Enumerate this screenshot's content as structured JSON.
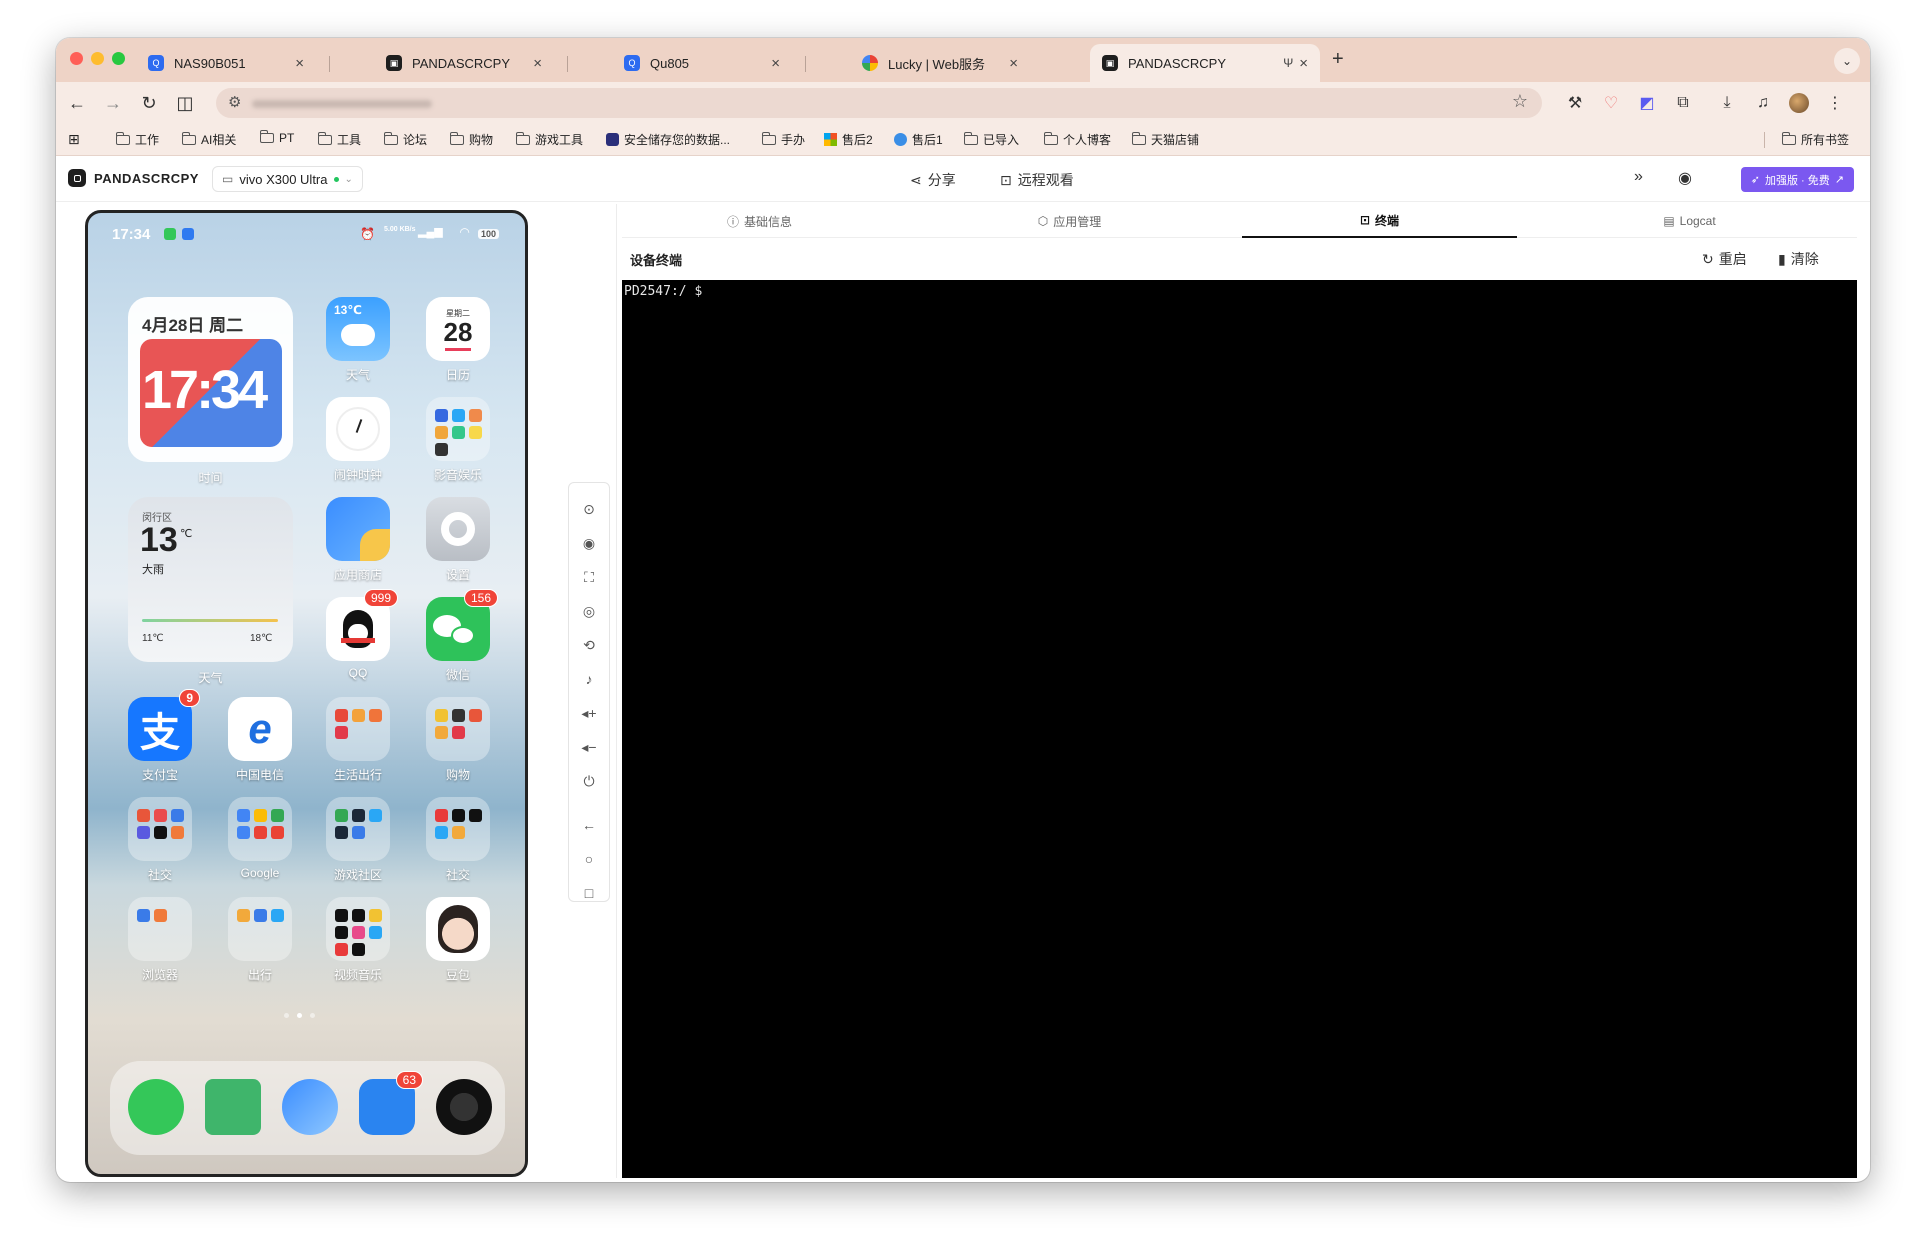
{
  "browser": {
    "tabs": [
      {
        "title": "NAS90B051",
        "favicon": "qnap-icon",
        "active": false
      },
      {
        "title": "PANDASCRCPY",
        "favicon": "pandascrcpy-icon",
        "active": false
      },
      {
        "title": "Qu805",
        "favicon": "qnap-icon",
        "active": false
      },
      {
        "title": "Lucky | Web服务",
        "favicon": "lucky-icon",
        "active": false
      },
      {
        "title": "PANDASCRCPY",
        "favicon": "pandascrcpy-icon",
        "active": true
      }
    ],
    "bookmarks": [
      {
        "label": "工作",
        "icon": "folder-icon"
      },
      {
        "label": "AI相关",
        "icon": "folder-icon"
      },
      {
        "label": "PT",
        "icon": "folder-icon"
      },
      {
        "label": "工具",
        "icon": "folder-icon"
      },
      {
        "label": "论坛",
        "icon": "folder-icon"
      },
      {
        "label": "购物",
        "icon": "folder-icon"
      },
      {
        "label": "游戏工具",
        "icon": "folder-icon"
      },
      {
        "label": "安全储存您的数据...",
        "icon": "app-icon"
      },
      {
        "label": "手办",
        "icon": "folder-icon"
      },
      {
        "label": "售后2",
        "icon": "windows-icon"
      },
      {
        "label": "售后1",
        "icon": "azure-icon"
      },
      {
        "label": "已导入",
        "icon": "folder-icon"
      },
      {
        "label": "个人博客",
        "icon": "folder-icon"
      },
      {
        "label": "天猫店铺",
        "icon": "folder-icon"
      }
    ],
    "all_bookmarks": "所有书签"
  },
  "app": {
    "brand": "PANDASCRCPY",
    "device": "vivo X300 Ultra",
    "share": "分享",
    "remote_view": "远程观看",
    "pro_button": "加强版 · 免费",
    "tabs": [
      {
        "label": "基础信息",
        "icon": "info-icon"
      },
      {
        "label": "应用管理",
        "icon": "package-icon"
      },
      {
        "label": "终端",
        "icon": "terminal-icon"
      },
      {
        "label": "Logcat",
        "icon": "log-icon"
      }
    ],
    "active_tab": "终端",
    "terminal": {
      "title": "设备终端",
      "restart": "重启",
      "clear": "清除",
      "prompt": "PD2547:/ $"
    }
  },
  "phone": {
    "status": {
      "time": "17:34",
      "net": "5.00 KB/s",
      "battery": "100"
    },
    "date_widget": {
      "date": "4月28日 周二",
      "clock": "17:34",
      "label": "时间"
    },
    "weather_widget": {
      "location": "闵行区",
      "temp": "13",
      "unit": "℃",
      "desc": "大雨",
      "low": "11℃",
      "high": "18℃",
      "label": "天气"
    },
    "apps": [
      {
        "name": "天气",
        "extra": "13℃"
      },
      {
        "name": "日历",
        "weekday": "星期二",
        "day": "28"
      },
      {
        "name": "闹钟时钟"
      },
      {
        "name": "影音娱乐"
      },
      {
        "name": "应用商店"
      },
      {
        "name": "设置"
      },
      {
        "name": "QQ",
        "badge": "999"
      },
      {
        "name": "微信",
        "badge": "156"
      },
      {
        "name": "支付宝",
        "badge": "9"
      },
      {
        "name": "中国电信"
      },
      {
        "name": "生活出行"
      },
      {
        "name": "购物"
      },
      {
        "name": "社交"
      },
      {
        "name": "Google"
      },
      {
        "name": "游戏社区"
      },
      {
        "name": "社交"
      },
      {
        "name": "浏览器"
      },
      {
        "name": "出行"
      },
      {
        "name": "视频音乐"
      },
      {
        "name": "豆包"
      }
    ],
    "dock_badge": "63"
  },
  "colors": {
    "tabstrip": "#eed3c6",
    "toolbar": "#f7ebe5",
    "accent": "#7b58f0",
    "terminal_bg": "#000000"
  }
}
